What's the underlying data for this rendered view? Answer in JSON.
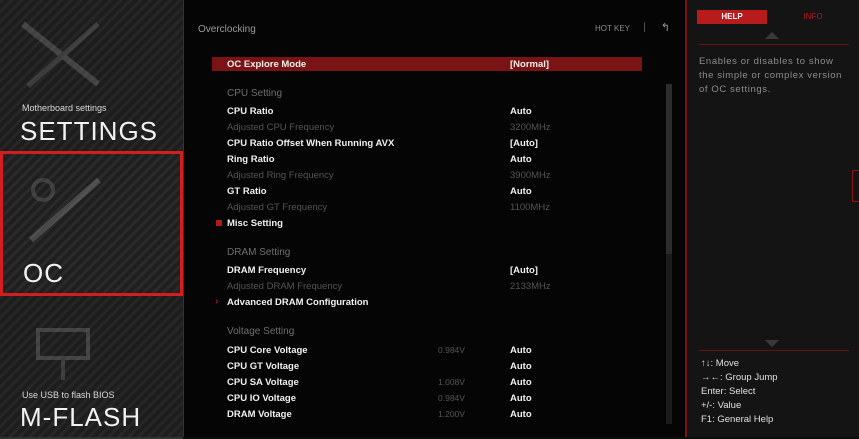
{
  "sidebar": {
    "settings": {
      "small": "Motherboard settings",
      "big": "SETTINGS"
    },
    "oc": {
      "big": "OC"
    },
    "mflash": {
      "small": "Use USB to flash BIOS",
      "big": "M-FLASH"
    }
  },
  "main": {
    "title": "Overclocking",
    "hotkey": "HOT KEY",
    "sep": "|",
    "back": "↰",
    "rows": [
      {
        "label": "OC Explore Mode",
        "value": "[Normal]"
      },
      {
        "section": "CPU Setting"
      },
      {
        "label": "CPU Ratio",
        "value": "Auto"
      },
      {
        "label": "Adjusted CPU Frequency",
        "value": "3200MHz"
      },
      {
        "label": "CPU Ratio Offset When Running AVX",
        "value": "[Auto]"
      },
      {
        "label": "Ring Ratio",
        "value": "Auto"
      },
      {
        "label": "Adjusted Ring Frequency",
        "value": "3900MHz"
      },
      {
        "label": "GT Ratio",
        "value": "Auto"
      },
      {
        "label": "Adjusted GT Frequency",
        "value": "1100MHz"
      },
      {
        "label": "Misc Setting"
      },
      {
        "section": "DRAM Setting"
      },
      {
        "label": "DRAM Frequency",
        "value": "[Auto]"
      },
      {
        "label": "Adjusted DRAM Frequency",
        "value": "2133MHz"
      },
      {
        "label": "Advanced DRAM Configuration"
      },
      {
        "section": "Voltage Setting"
      },
      {
        "label": "CPU Core Voltage",
        "current": "0.984V",
        "value": "Auto"
      },
      {
        "label": "CPU GT Voltage",
        "value": "Auto"
      },
      {
        "label": "CPU SA Voltage",
        "current": "1.008V",
        "value": "Auto"
      },
      {
        "label": "CPU IO Voltage",
        "current": "0.984V",
        "value": "Auto"
      },
      {
        "label": "DRAM Voltage",
        "current": "1.200V",
        "value": "Auto"
      }
    ]
  },
  "help": {
    "tab_help": "HELP",
    "tab_info": "INFO",
    "text": "Enables or disables to show the simple or complex version of OC settings.",
    "keys": [
      "↑↓: Move",
      "→←: Group Jump",
      "Enter: Select",
      "+/-: Value",
      "F1: General Help"
    ]
  },
  "colors": {
    "accent": "#b81b1b",
    "selected_row": "#7a1414",
    "background": "#050505"
  }
}
